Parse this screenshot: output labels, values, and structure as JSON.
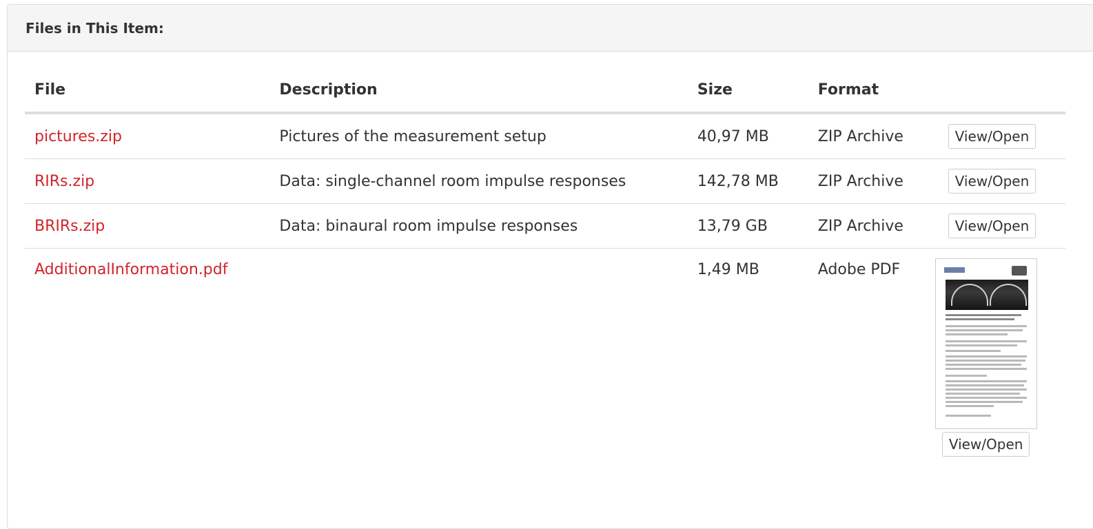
{
  "panel": {
    "title": "Files in This Item:"
  },
  "table": {
    "headers": {
      "file": "File",
      "description": "Description",
      "size": "Size",
      "format": "Format"
    },
    "rows": [
      {
        "file": "pictures.zip",
        "description": "Pictures of the measurement setup",
        "size": "40,97 MB",
        "format": "ZIP Archive",
        "action": "View/Open"
      },
      {
        "file": "RIRs.zip",
        "description": "Data: single-channel room impulse responses",
        "size": "142,78 MB",
        "format": "ZIP Archive",
        "action": "View/Open"
      },
      {
        "file": "BRIRs.zip",
        "description": "Data: binaural room impulse responses",
        "size": "13,79 GB",
        "format": "ZIP Archive",
        "action": "View/Open"
      },
      {
        "file": "AdditionalInformation.pdf",
        "description": "",
        "size": "1,49 MB",
        "format": "Adobe PDF",
        "action": "View/Open",
        "thumbnail": "pdf-thumbnail"
      }
    ]
  },
  "colors": {
    "link": "#d2232a",
    "heading_bg": "#f5f5f5",
    "border": "#dddddd"
  }
}
